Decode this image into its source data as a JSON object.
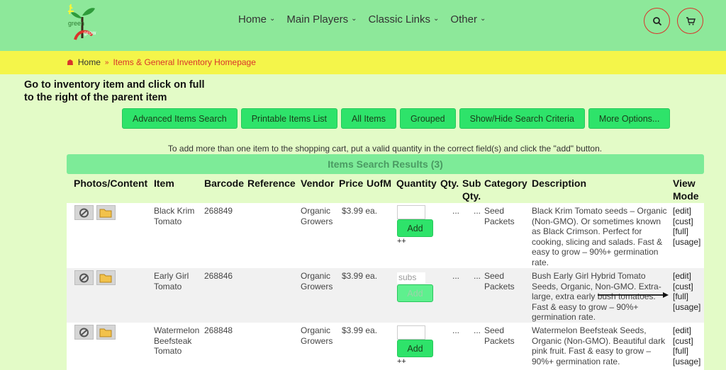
{
  "logo": {
    "text1": "green",
    "text2": "grow"
  },
  "nav": {
    "items": [
      {
        "label": "Home"
      },
      {
        "label": "Main Players"
      },
      {
        "label": "Classic Links"
      },
      {
        "label": "Other"
      }
    ]
  },
  "breadcrumb": {
    "home": "Home",
    "current": "Items & General Inventory Homepage"
  },
  "instruction": "Go to inventory item and click on full to the right of the parent item",
  "buttons": [
    "Advanced Items Search",
    "Printable Items List",
    "All Items",
    "Grouped",
    "Show/Hide Search Criteria",
    "More Options..."
  ],
  "note": "To add more than one item to the shopping cart, put a valid quantity in the correct field(s) and click the \"add\" button.",
  "results_title": "Items Search Results (3)",
  "columns": {
    "photos": "Photos/Content",
    "item": "Item",
    "barcode": "Barcode",
    "reference": "Reference",
    "vendor": "Vendor",
    "price": "Price",
    "uofm": "UofM",
    "quantity": "Quantity",
    "qty": "Qty.",
    "subqty": "Sub Qty.",
    "category": "Category",
    "description": "Description",
    "view": "View Mode"
  },
  "rows": [
    {
      "name": "Black Krim Tomato",
      "barcode": "268849",
      "vendor": "Organic Growers",
      "price": "$3.99 ea.",
      "qty_value": "",
      "add_label": "Add",
      "plus": "++",
      "qty_dots": "...",
      "sub_dots": "...",
      "category": "Seed Packets",
      "description": "Black Krim Tomato seeds – Organic (Non-GMO). Or sometimes known as Black Crimson. Perfect for cooking, slicing and salads. Fast & easy to grow – 90%+ germination rate.",
      "links": [
        "[edit]",
        "[cust]",
        "[full]",
        "[usage]"
      ]
    },
    {
      "name": "Early Girl Tomato",
      "barcode": "268846",
      "vendor": "Organic Growers",
      "price": "$3.99 ea.",
      "qty_value": "subs",
      "add_label": "Add",
      "plus": "",
      "qty_dots": "...",
      "sub_dots": "...",
      "category": "Seed Packets",
      "description": "Bush Early Girl Hybrid Tomato Seeds, Organic, Non-GMO. Extra-large, extra early bush tomatoes. Fast & easy to grow – 90%+ germination rate.",
      "links": [
        "[edit]",
        "[cust]",
        "[full]",
        "[usage]"
      ]
    },
    {
      "name": "Watermelon Beefsteak Tomato",
      "barcode": "268848",
      "vendor": "Organic Growers",
      "price": "$3.99 ea.",
      "qty_value": "",
      "add_label": "Add",
      "plus": "++",
      "qty_dots": "...",
      "sub_dots": "...",
      "category": "Seed Packets",
      "description": "Watermelon Beefsteak Seeds, Organic (Non-GMO). Beautiful dark pink fruit. Fast & easy to grow – 90%+ germination rate.",
      "links": [
        "[edit]",
        "[cust]",
        "[full]",
        "[usage]"
      ]
    }
  ],
  "colors": {
    "header": "#8de89a",
    "breadcrumb": "#f4f54a",
    "button": "#2ee36a",
    "accent": "#d9342b"
  }
}
